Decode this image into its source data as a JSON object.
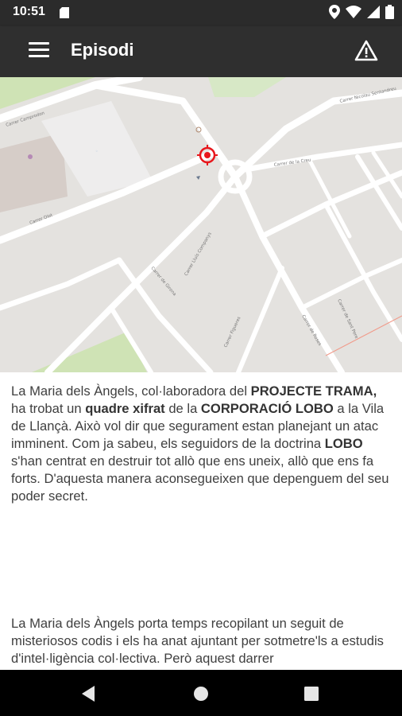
{
  "status": {
    "time": "10:51"
  },
  "app_bar": {
    "title": "Episodi",
    "menu_icon": "hamburger-menu-icon",
    "warning_icon": "warning-triangle-icon"
  },
  "map": {
    "street_labels": [
      "Carrer Camprodon",
      "Carrer Nicolau Sentandreu",
      "Carrer de la Creu",
      "Carrer Olot",
      "Carrer Lluís Companys",
      "Carrer de Girona",
      "Carrer Figueres",
      "Carrer de Roses",
      "Carrer de Sant Pere"
    ],
    "marker_icon": "location-target-icon",
    "accent": "#e8161b"
  },
  "story": {
    "p1": [
      {
        "t": "La Maria dels Àngels, col·laboradora del ",
        "b": false
      },
      {
        "t": "PROJECTE TRAMA,",
        "b": true
      },
      {
        "t": " ha trobat un ",
        "b": false
      },
      {
        "t": "quadre xifrat",
        "b": true
      },
      {
        "t": " de la ",
        "b": false
      },
      {
        "t": "CORPORACIÓ LOBO",
        "b": true
      },
      {
        "t": " a la Vila de Llançà. Això vol dir que segurament estan planejant un atac imminent. Com ja sabeu, els seguidors de la doctrina ",
        "b": false
      },
      {
        "t": "LOBO",
        "b": true
      },
      {
        "t": " s'han centrat en destruir tot allò que ens uneix, allò que ens fa forts. D'aquesta manera aconsegueixen que depenguem del seu poder secret.",
        "b": false
      }
    ],
    "p2": "La Maria dels Àngels porta temps recopilant un seguit de misteriosos codis i els ha anat ajuntant per sotmetre'ls a estudis d'intel·ligència col·lectiva. Però aquest darrer"
  },
  "nav": {
    "back_icon": "back-triangle-icon",
    "home_icon": "home-circle-icon",
    "recents_icon": "recents-square-icon"
  }
}
